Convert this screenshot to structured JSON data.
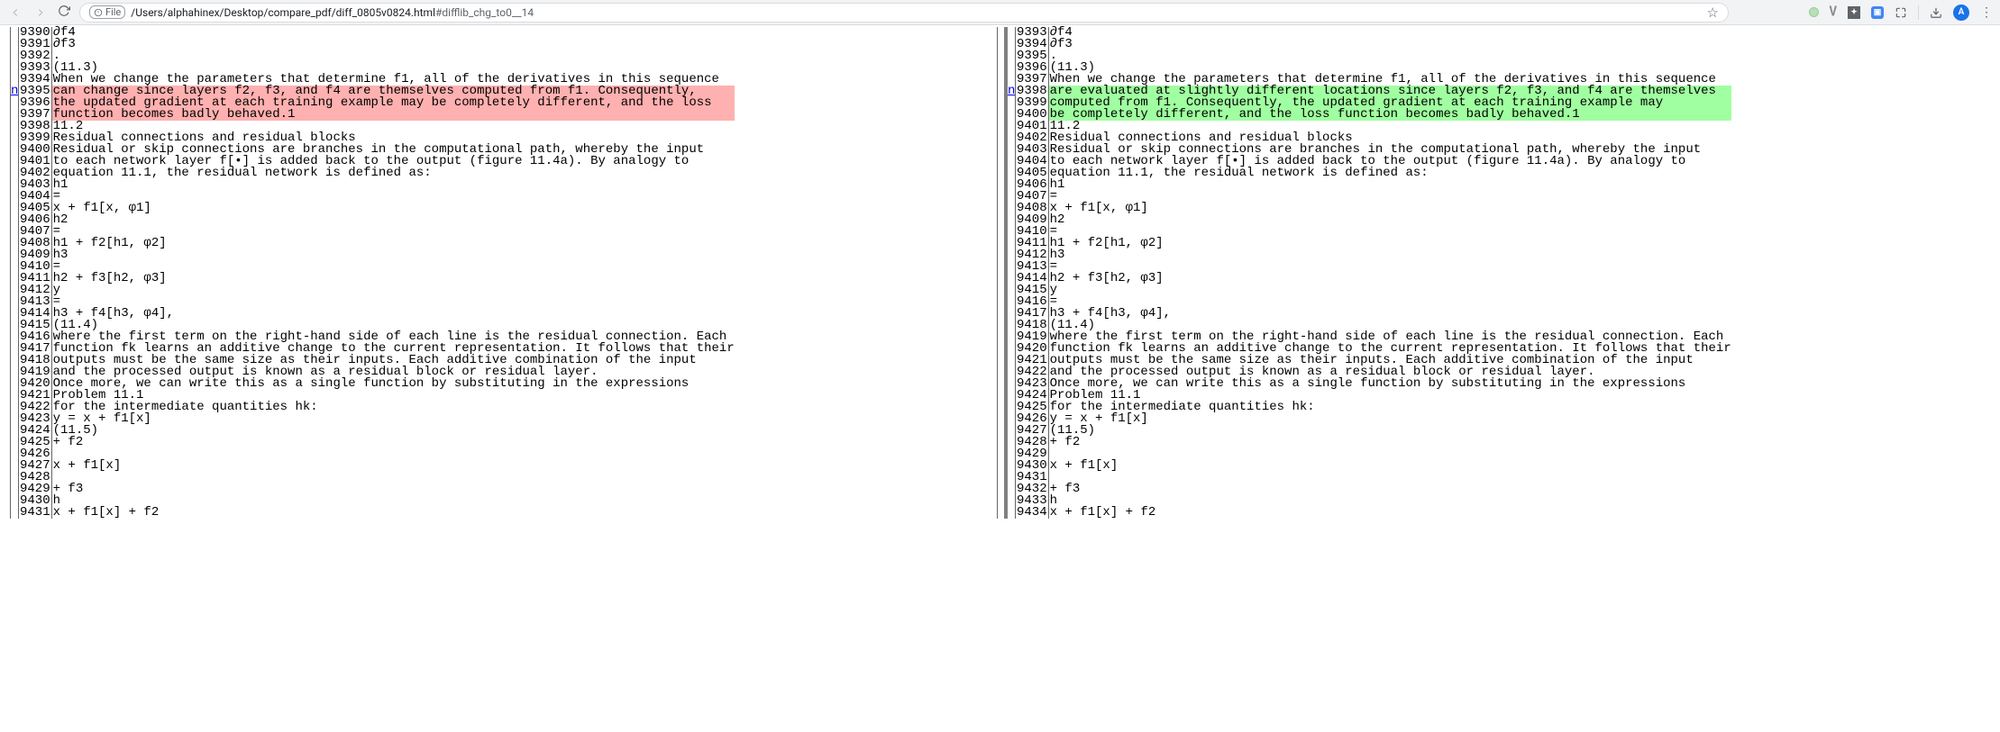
{
  "browser": {
    "url_path": "/Users/alphahinex/Desktop/compare_pdf/diff_0805v0824.html",
    "url_frag": "#difflib_chg_to0__14",
    "file_label": "File",
    "avatar_initial": "A"
  },
  "diff": {
    "left": {
      "nav_link_row": 5,
      "nav_text": "n",
      "rows": [
        {
          "n": "9390",
          "t": "∂f4",
          "c": ""
        },
        {
          "n": "9391",
          "t": "∂f3",
          "c": ""
        },
        {
          "n": "9392",
          "t": ".",
          "c": ""
        },
        {
          "n": "9393",
          "t": "(11.3)",
          "c": ""
        },
        {
          "n": "9394",
          "t": "When we change the parameters that determine f1, all of the derivatives in this sequence",
          "c": ""
        },
        {
          "n": "9395",
          "t": "can change since layers f2, f3, and f4 are themselves computed from f1. Consequently,",
          "c": "chg-del"
        },
        {
          "n": "9396",
          "t": "the updated gradient at each training example may be completely different, and the loss",
          "c": "chg-del"
        },
        {
          "n": "9397",
          "t": "function becomes badly behaved.1",
          "c": "chg-del"
        },
        {
          "n": "9398",
          "t": "11.2",
          "c": ""
        },
        {
          "n": "9399",
          "t": "Residual connections and residual blocks",
          "c": ""
        },
        {
          "n": "9400",
          "t": "Residual or skip connections are branches in the computational path, whereby the input",
          "c": ""
        },
        {
          "n": "9401",
          "t": "to each network layer f[•] is added back to the output (figure 11.4a). By analogy to",
          "c": ""
        },
        {
          "n": "9402",
          "t": "equation 11.1, the residual network is defined as:",
          "c": ""
        },
        {
          "n": "9403",
          "t": "h1",
          "c": ""
        },
        {
          "n": "9404",
          "t": "=",
          "c": ""
        },
        {
          "n": "9405",
          "t": "x + f1[x, φ1]",
          "c": ""
        },
        {
          "n": "9406",
          "t": "h2",
          "c": ""
        },
        {
          "n": "9407",
          "t": "=",
          "c": ""
        },
        {
          "n": "9408",
          "t": "h1 + f2[h1, φ2]",
          "c": ""
        },
        {
          "n": "9409",
          "t": "h3",
          "c": ""
        },
        {
          "n": "9410",
          "t": "=",
          "c": ""
        },
        {
          "n": "9411",
          "t": "h2 + f3[h2, φ3]",
          "c": ""
        },
        {
          "n": "9412",
          "t": "y",
          "c": ""
        },
        {
          "n": "9413",
          "t": "=",
          "c": ""
        },
        {
          "n": "9414",
          "t": "h3 + f4[h3, φ4],",
          "c": ""
        },
        {
          "n": "9415",
          "t": "(11.4)",
          "c": ""
        },
        {
          "n": "9416",
          "t": "where the first term on the right-hand side of each line is the residual connection. Each",
          "c": ""
        },
        {
          "n": "9417",
          "t": "function fk learns an additive change to the current representation. It follows that their",
          "c": ""
        },
        {
          "n": "9418",
          "t": "outputs must be the same size as their inputs. Each additive combination of the input",
          "c": ""
        },
        {
          "n": "9419",
          "t": "and the processed output is known as a residual block or residual layer.",
          "c": ""
        },
        {
          "n": "9420",
          "t": "Once more, we can write this as a single function by substituting in the expressions",
          "c": ""
        },
        {
          "n": "9421",
          "t": "Problem 11.1",
          "c": ""
        },
        {
          "n": "9422",
          "t": "for the intermediate quantities hk:",
          "c": ""
        },
        {
          "n": "9423",
          "t": "y = x + f1[x]",
          "c": ""
        },
        {
          "n": "9424",
          "t": "(11.5)",
          "c": ""
        },
        {
          "n": "9425",
          "t": "+ f2",
          "c": ""
        },
        {
          "n": "9426",
          "t": "",
          "c": ""
        },
        {
          "n": "9427",
          "t": "x + f1[x]",
          "c": ""
        },
        {
          "n": "9428",
          "t": "",
          "c": ""
        },
        {
          "n": "9429",
          "t": "+ f3",
          "c": ""
        },
        {
          "n": "9430",
          "t": "h",
          "c": ""
        },
        {
          "n": "9431",
          "t": "x + f1[x] + f2",
          "c": ""
        }
      ]
    },
    "right": {
      "nav_link_row": 5,
      "nav_text": "n",
      "rows": [
        {
          "n": "9393",
          "t": "∂f4",
          "c": ""
        },
        {
          "n": "9394",
          "t": "∂f3",
          "c": ""
        },
        {
          "n": "9395",
          "t": ".",
          "c": ""
        },
        {
          "n": "9396",
          "t": "(11.3)",
          "c": ""
        },
        {
          "n": "9397",
          "t": "When we change the parameters that determine f1, all of the derivatives in this sequence",
          "c": ""
        },
        {
          "n": "9398",
          "t": "are evaluated at slightly different locations since layers f2, f3, and f4 are themselves",
          "c": "chg-add"
        },
        {
          "n": "9399",
          "t": "computed from f1. Consequently, the updated gradient at each training example may",
          "c": "chg-add"
        },
        {
          "n": "9400",
          "t": "be completely different, and the loss function becomes badly behaved.1",
          "c": "chg-add"
        },
        {
          "n": "9401",
          "t": "11.2",
          "c": ""
        },
        {
          "n": "9402",
          "t": "Residual connections and residual blocks",
          "c": ""
        },
        {
          "n": "9403",
          "t": "Residual or skip connections are branches in the computational path, whereby the input",
          "c": ""
        },
        {
          "n": "9404",
          "t": "to each network layer f[•] is added back to the output (figure 11.4a). By analogy to",
          "c": ""
        },
        {
          "n": "9405",
          "t": "equation 11.1, the residual network is defined as:",
          "c": ""
        },
        {
          "n": "9406",
          "t": "h1",
          "c": ""
        },
        {
          "n": "9407",
          "t": "=",
          "c": ""
        },
        {
          "n": "9408",
          "t": "x + f1[x, φ1]",
          "c": ""
        },
        {
          "n": "9409",
          "t": "h2",
          "c": ""
        },
        {
          "n": "9410",
          "t": "=",
          "c": ""
        },
        {
          "n": "9411",
          "t": "h1 + f2[h1, φ2]",
          "c": ""
        },
        {
          "n": "9412",
          "t": "h3",
          "c": ""
        },
        {
          "n": "9413",
          "t": "=",
          "c": ""
        },
        {
          "n": "9414",
          "t": "h2 + f3[h2, φ3]",
          "c": ""
        },
        {
          "n": "9415",
          "t": "y",
          "c": ""
        },
        {
          "n": "9416",
          "t": "=",
          "c": ""
        },
        {
          "n": "9417",
          "t": "h3 + f4[h3, φ4],",
          "c": ""
        },
        {
          "n": "9418",
          "t": "(11.4)",
          "c": ""
        },
        {
          "n": "9419",
          "t": "where the first term on the right-hand side of each line is the residual connection. Each",
          "c": ""
        },
        {
          "n": "9420",
          "t": "function fk learns an additive change to the current representation. It follows that their",
          "c": ""
        },
        {
          "n": "9421",
          "t": "outputs must be the same size as their inputs. Each additive combination of the input",
          "c": ""
        },
        {
          "n": "9422",
          "t": "and the processed output is known as a residual block or residual layer.",
          "c": ""
        },
        {
          "n": "9423",
          "t": "Once more, we can write this as a single function by substituting in the expressions",
          "c": ""
        },
        {
          "n": "9424",
          "t": "Problem 11.1",
          "c": ""
        },
        {
          "n": "9425",
          "t": "for the intermediate quantities hk:",
          "c": ""
        },
        {
          "n": "9426",
          "t": "y = x + f1[x]",
          "c": ""
        },
        {
          "n": "9427",
          "t": "(11.5)",
          "c": ""
        },
        {
          "n": "9428",
          "t": "+ f2",
          "c": ""
        },
        {
          "n": "9429",
          "t": "",
          "c": ""
        },
        {
          "n": "9430",
          "t": "x + f1[x]",
          "c": ""
        },
        {
          "n": "9431",
          "t": "",
          "c": ""
        },
        {
          "n": "9432",
          "t": "+ f3",
          "c": ""
        },
        {
          "n": "9433",
          "t": "h",
          "c": ""
        },
        {
          "n": "9434",
          "t": "x + f1[x] + f2",
          "c": ""
        }
      ]
    }
  }
}
